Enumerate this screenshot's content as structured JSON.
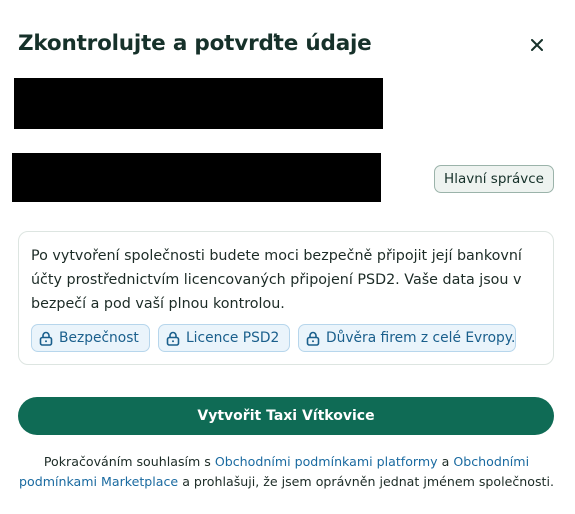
{
  "dialog": {
    "title": "Zkontrolujte a potvrďte údaje",
    "close_icon": "close-icon"
  },
  "person": {
    "role_badge": "Hlavní správce"
  },
  "info_card": {
    "text": "Po vytvoření společnosti budete moci bezpečně připojit její bankovní účty prostřednictvím licencovaných připojení PSD2. Vaše data jsou v bezpečí a pod vaší plnou kontrolou.",
    "chips": [
      {
        "label": "Bezpečnost",
        "icon": "lock-icon"
      },
      {
        "label": "Licence PSD2",
        "icon": "lock-icon"
      },
      {
        "label": "Důvěra firem z celé Evropy.",
        "icon": "lock-icon"
      }
    ]
  },
  "cta": {
    "label": "Vytvořit Taxi Vítkovice"
  },
  "legal": {
    "part1": "Pokračováním souhlasím s ",
    "link1": "Obchodními podmínkami platformy",
    "part2": " a ",
    "link2": "Obchodními podmínkami Marketplace",
    "part3": " a prohlašuji, že jsem oprávněn jednat jménem společnosti."
  },
  "colors": {
    "primary": "#0f6b55",
    "title": "#16312a",
    "link": "#1a6aa0",
    "chip_bg": "#eaf4fb"
  }
}
